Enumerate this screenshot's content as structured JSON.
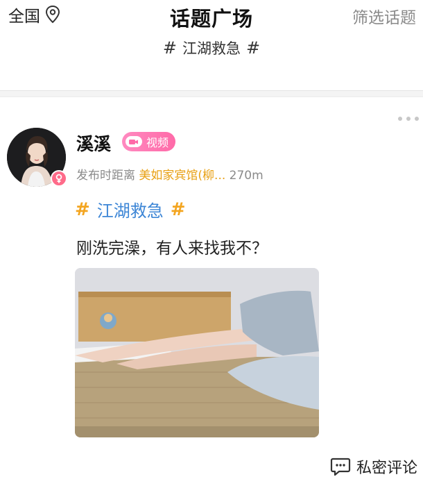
{
  "header": {
    "location": "全国",
    "title": "话题广场",
    "filter": "筛选话题",
    "topic_hash_left": "#",
    "topic": "江湖救急",
    "topic_hash_right": "#"
  },
  "post": {
    "username": "溪溪",
    "badge": "视频",
    "meta_prefix": "发布时距离",
    "venue": "美如家宾馆(柳...",
    "distance": "270m",
    "topic_hash_left": "#",
    "topic": "江湖救急",
    "topic_hash_right": "#",
    "text": "刚洗完澡，有人来找我不？",
    "comment_label": "私密评论"
  },
  "colors": {
    "accent_orange": "#f3a520",
    "link_blue": "#3d86d6",
    "venue_orange": "#e8a013",
    "badge_pink": "#ff6aa8"
  },
  "icons": [
    "location-pin-icon",
    "video-camera-icon",
    "female-gender-icon",
    "more-dots-icon",
    "chat-bubble-icon"
  ]
}
